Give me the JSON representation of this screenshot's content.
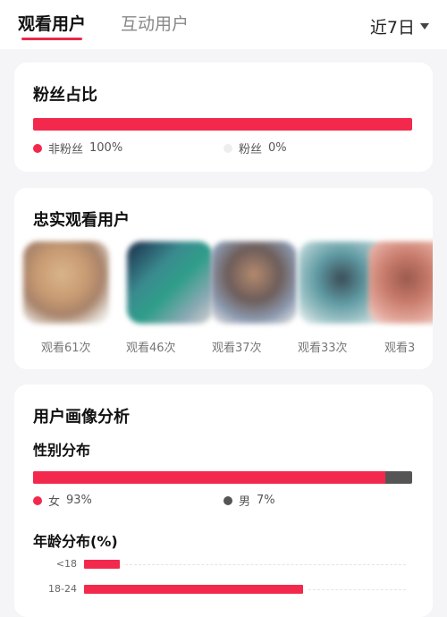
{
  "topbar": {
    "tab_viewers": "观看用户",
    "tab_interactive": "互动用户",
    "range": "近7日"
  },
  "fan_ratio": {
    "title": "粉丝占比",
    "non_fans_label": "非粉丝",
    "non_fans_value": "100%",
    "fans_label": "粉丝",
    "fans_value": "0%",
    "non_fans_fraction": 1.0,
    "colors": {
      "non_fans": "#f2294c",
      "fans": "#eeeeee"
    }
  },
  "loyal_viewers": {
    "title": "忠实观看用户",
    "users": [
      {
        "name": "",
        "views": "观看61次"
      },
      {
        "name": "",
        "views": "观看46次"
      },
      {
        "name": "",
        "views": "观看37次"
      },
      {
        "name": "",
        "views": "观看33次"
      },
      {
        "name": "",
        "views": "观看3"
      }
    ]
  },
  "profile": {
    "title": "用户画像分析",
    "gender": {
      "title": "性别分布",
      "female_label": "女",
      "female_value": "93%",
      "male_label": "男",
      "male_value": "7%",
      "female_fraction": 0.93,
      "colors": {
        "female": "#f2294c",
        "male": "#555555"
      }
    },
    "age": {
      "title": "年龄分布(%)",
      "groups": [
        {
          "label": "<18",
          "value": 11
        },
        {
          "label": "18-24",
          "value": 68
        }
      ],
      "axis_max": 100
    }
  }
}
